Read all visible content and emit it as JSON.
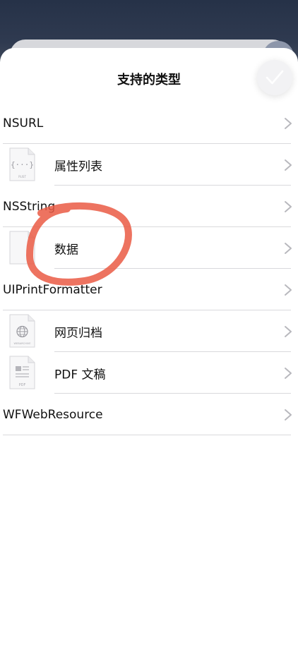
{
  "sheet": {
    "title": "支持的类型"
  },
  "rows": [
    {
      "kind": "type",
      "label": "NSURL"
    },
    {
      "kind": "sub",
      "label": "属性列表",
      "icon": "plist-file-icon",
      "icon_caption": "PLIST"
    },
    {
      "kind": "type",
      "label": "NSString"
    },
    {
      "kind": "sub",
      "label": "数据",
      "icon": "blank-file-icon",
      "icon_caption": ""
    },
    {
      "kind": "type",
      "label": "UIPrintFormatter"
    },
    {
      "kind": "sub",
      "label": "网页归档",
      "icon": "webarchive-file-icon",
      "icon_caption": "WEBARCHIVE"
    },
    {
      "kind": "sub",
      "label": "PDF 文稿",
      "icon": "pdf-file-icon",
      "icon_caption": "PDF"
    },
    {
      "kind": "type",
      "label": "WFWebResource"
    }
  ],
  "colors": {
    "annotation": "#ea5a44",
    "chevron": "#b8b8bd",
    "separator": "#d9d9dc",
    "checkmark": "#ffffff"
  }
}
